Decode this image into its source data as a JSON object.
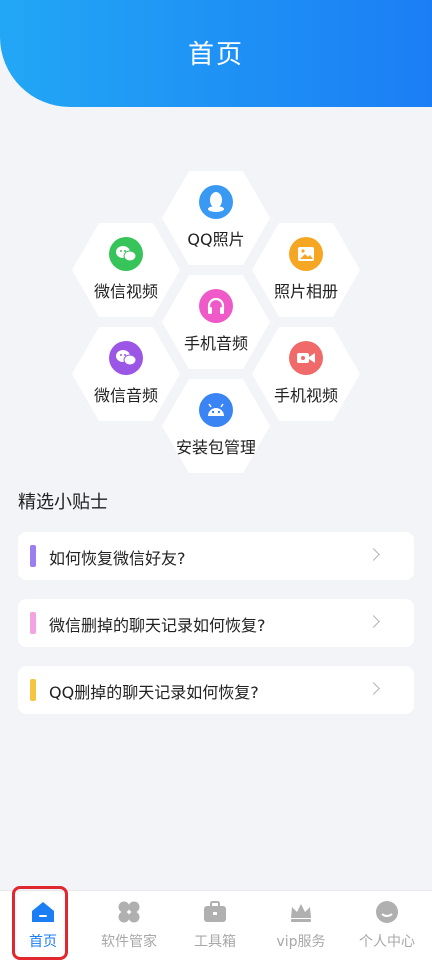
{
  "header": {
    "title": "首页"
  },
  "features": [
    {
      "label": "QQ照片"
    },
    {
      "label": "微信视频"
    },
    {
      "label": "照片相册"
    },
    {
      "label": "手机音频"
    },
    {
      "label": "微信音频"
    },
    {
      "label": "手机视频"
    },
    {
      "label": "安装包管理"
    }
  ],
  "tips": {
    "title": "精选小贴士",
    "items": [
      {
        "text": "如何恢复微信好友?",
        "color": "#9b7ef0"
      },
      {
        "text": "微信删掉的聊天记录如何恢复?",
        "color": "#f3a3e0"
      },
      {
        "text": "QQ删掉的聊天记录如何恢复?",
        "color": "#f5c542"
      }
    ]
  },
  "tabbar": {
    "items": [
      {
        "label": "首页"
      },
      {
        "label": "软件管家"
      },
      {
        "label": "工具箱"
      },
      {
        "label": "vip服务"
      },
      {
        "label": "个人中心"
      }
    ]
  },
  "colors": {
    "accent": "#1b7ef5",
    "inactive": "#a8a8a8",
    "highlight": "#e0282e"
  }
}
